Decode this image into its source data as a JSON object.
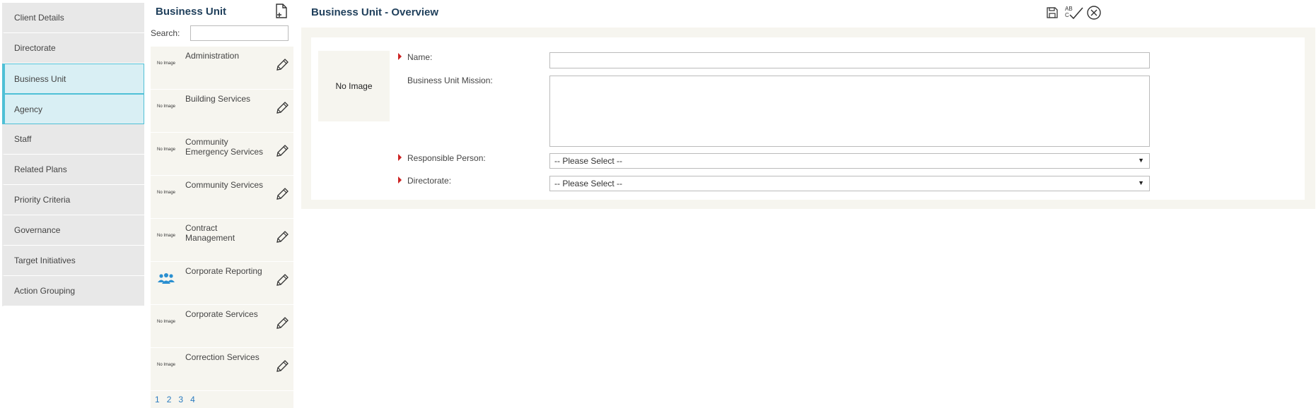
{
  "nav": {
    "items": [
      {
        "label": "Client Details",
        "active": false
      },
      {
        "label": "Directorate",
        "active": false
      },
      {
        "label": "Business Unit",
        "active": true
      },
      {
        "label": "Agency",
        "active": true
      },
      {
        "label": "Staff",
        "active": false
      },
      {
        "label": "Related Plans",
        "active": false
      },
      {
        "label": "Priority Criteria",
        "active": false
      },
      {
        "label": "Governance",
        "active": false
      },
      {
        "label": "Target Initiatives",
        "active": false
      },
      {
        "label": "Action Grouping",
        "active": false
      }
    ]
  },
  "list": {
    "title": "Business Unit",
    "search_label": "Search:",
    "search_value": "",
    "no_image_text": "No Image",
    "rows": [
      {
        "name": "Administration",
        "thumb": "no-image"
      },
      {
        "name": "Building Services",
        "thumb": "no-image"
      },
      {
        "name": "Community Emergency Services",
        "thumb": "no-image"
      },
      {
        "name": "Community Services",
        "thumb": "no-image"
      },
      {
        "name": "Contract Management",
        "thumb": "no-image"
      },
      {
        "name": "Corporate Reporting",
        "thumb": "people-icon"
      },
      {
        "name": "Corporate Services",
        "thumb": "no-image"
      },
      {
        "name": "Correction Services",
        "thumb": "no-image"
      }
    ],
    "pages": [
      "1",
      "2",
      "3",
      "4"
    ]
  },
  "main": {
    "title": "Business Unit - Overview",
    "image_placeholder": "No Image",
    "fields": {
      "name_label": "Name:",
      "name_value": "",
      "mission_label": "Business Unit Mission:",
      "mission_value": "",
      "responsible_label": "Responsible Person:",
      "responsible_value": "-- Please Select --",
      "directorate_label": "Directorate:",
      "directorate_value": "-- Please Select --"
    },
    "toolbar": [
      "save-icon",
      "spellcheck-icon",
      "close-icon"
    ]
  },
  "colors": {
    "accent": "#4fc0d6",
    "title": "#1f3f5b",
    "required": "#cc2222",
    "link": "#2a7bbf",
    "panel_bg": "#f6f5ef"
  }
}
